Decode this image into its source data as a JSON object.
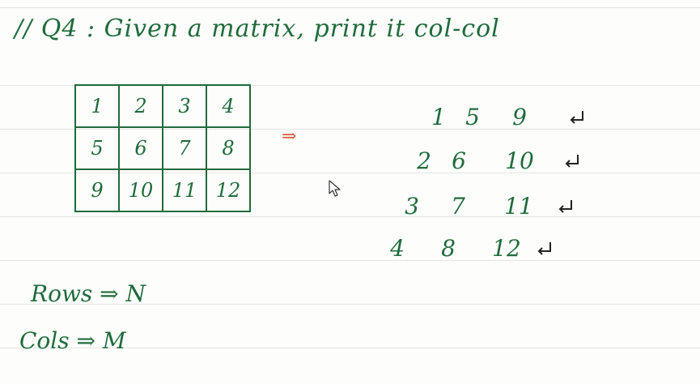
{
  "title": "// Q4 : Given a matrix, print it col-col",
  "matrix": [
    [
      "1",
      "2",
      "3",
      "4"
    ],
    [
      "5",
      "6",
      "7",
      "8"
    ],
    [
      "9",
      "10",
      "11",
      "12"
    ]
  ],
  "arrow_symbol": "⇒",
  "output_rows": [
    [
      "1",
      "5",
      "9"
    ],
    [
      "2",
      "6",
      "10"
    ],
    [
      "3",
      "7",
      "11"
    ],
    [
      "4",
      "8",
      "12"
    ]
  ],
  "icons": {
    "newline": "return-arrow-icon",
    "cursor": "mouse-pointer-icon"
  },
  "notes": {
    "rows": "Rows ⇒ N",
    "cols": "Cols ⇒ M"
  },
  "colors": {
    "ink": "#1f6b3a",
    "accent": "#d4593c"
  }
}
